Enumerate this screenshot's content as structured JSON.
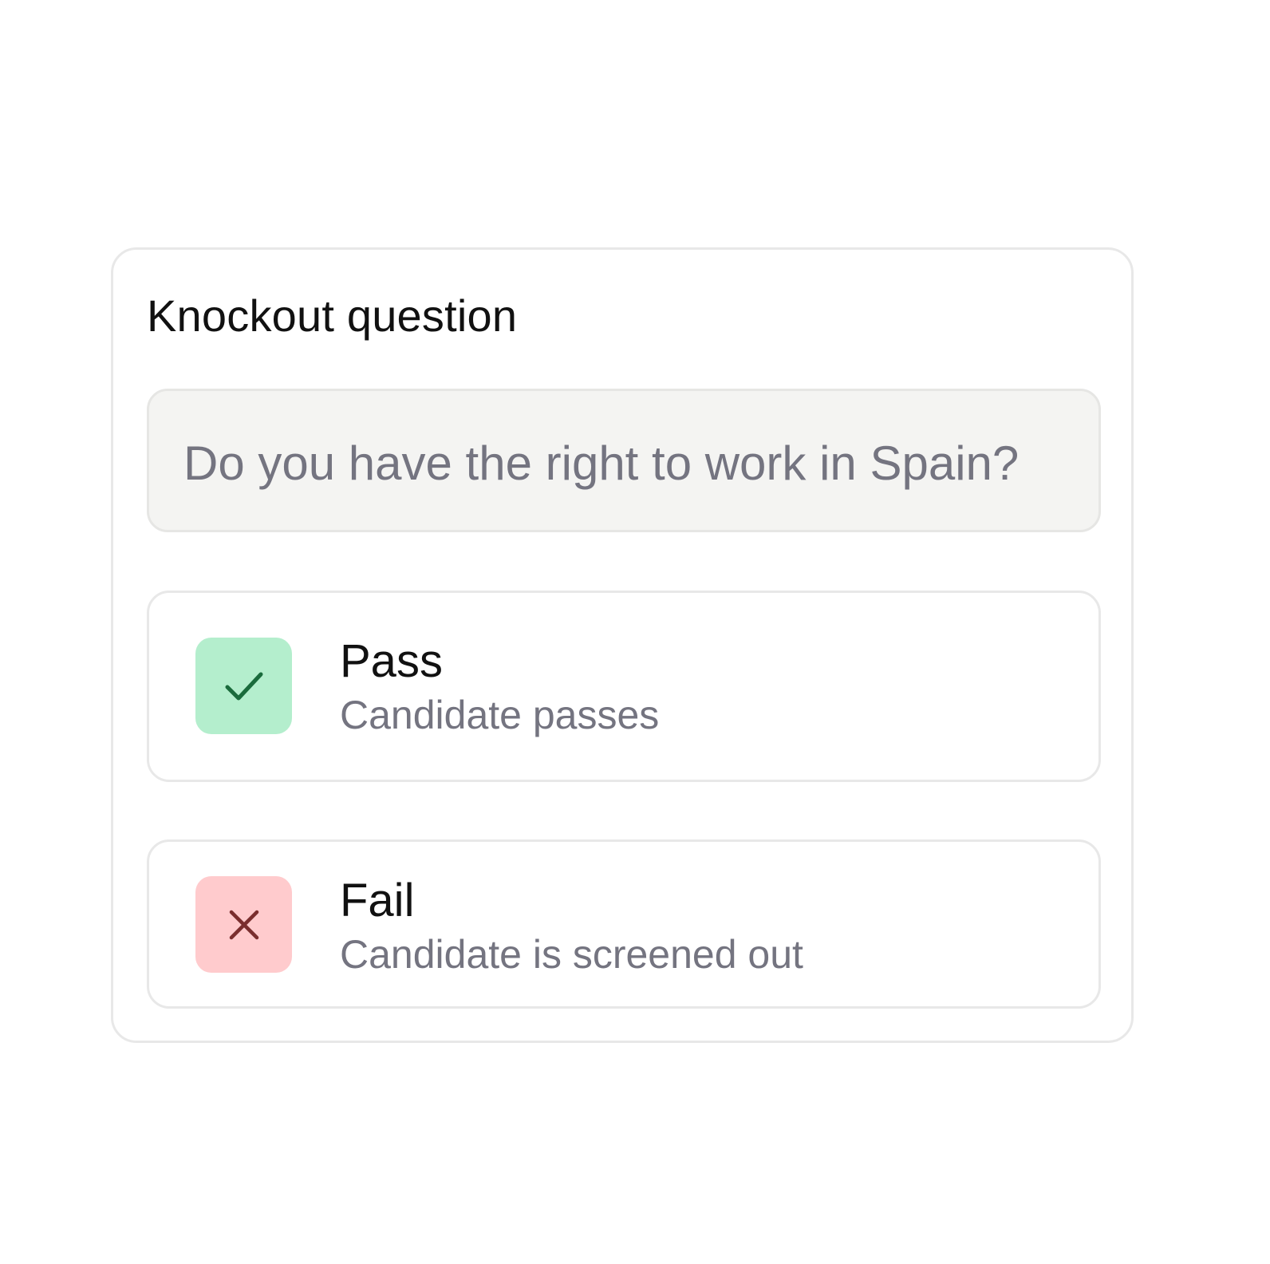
{
  "card": {
    "title": "Knockout question"
  },
  "question": {
    "value": "Do you have the right to work in Spain?"
  },
  "options": [
    {
      "label": "Pass",
      "description": "Candidate passes",
      "icon": "check-icon",
      "icon_color": "#1a6b3c",
      "icon_background": "#b4eecd"
    },
    {
      "label": "Fail",
      "description": "Candidate is screened out",
      "icon": "close-icon",
      "icon_color": "#7a2e2e",
      "icon_background": "#ffcbcd"
    }
  ]
}
